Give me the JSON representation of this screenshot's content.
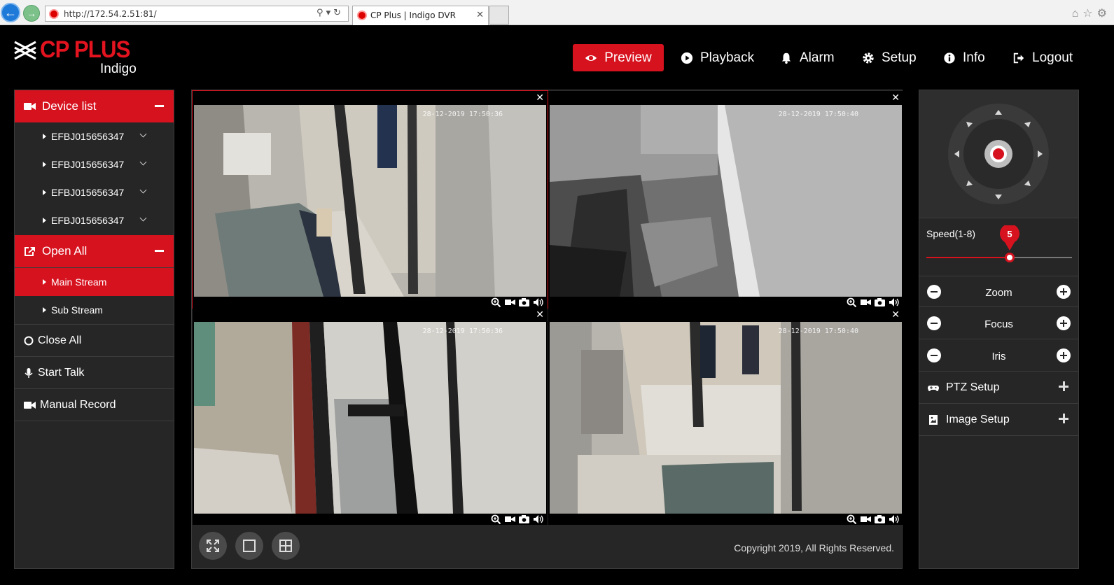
{
  "browser": {
    "url": "http://172.54.2.51:81/",
    "tab_title": "CP Plus | Indigo DVR"
  },
  "brand": {
    "name": "CP PLUS",
    "product": "Indigo",
    "accent_color": "#d7121f"
  },
  "topnav": {
    "preview": "Preview",
    "playback": "Playback",
    "alarm": "Alarm",
    "setup": "Setup",
    "info": "Info",
    "logout": "Logout"
  },
  "sidebar": {
    "device_list": "Device list",
    "devices": [
      "EFBJ015656347",
      "EFBJ015656347",
      "EFBJ015656347",
      "EFBJ015656347"
    ],
    "open_all": "Open All",
    "main_stream": "Main Stream",
    "sub_stream": "Sub Stream",
    "close_all": "Close All",
    "start_talk": "Start Talk",
    "manual_record": "Manual Record"
  },
  "cameras": [
    {
      "timestamp": "28-12-2019 17:50:36",
      "selected": true
    },
    {
      "timestamp": "28-12-2019 17:50:40",
      "selected": false
    },
    {
      "timestamp": "28-12-2019 17:50:36",
      "selected": false
    },
    {
      "timestamp": "28-12-2019 17:50:40",
      "selected": false
    }
  ],
  "footer": {
    "copyright": "Copyright 2019, All Rights Reserved."
  },
  "ptz": {
    "speed_label": "Speed(1-8)",
    "speed_value": "5",
    "speed_min": 1,
    "speed_max": 8,
    "zoom": "Zoom",
    "focus": "Focus",
    "iris": "Iris",
    "ptz_setup": "PTZ Setup",
    "image_setup": "Image Setup"
  }
}
